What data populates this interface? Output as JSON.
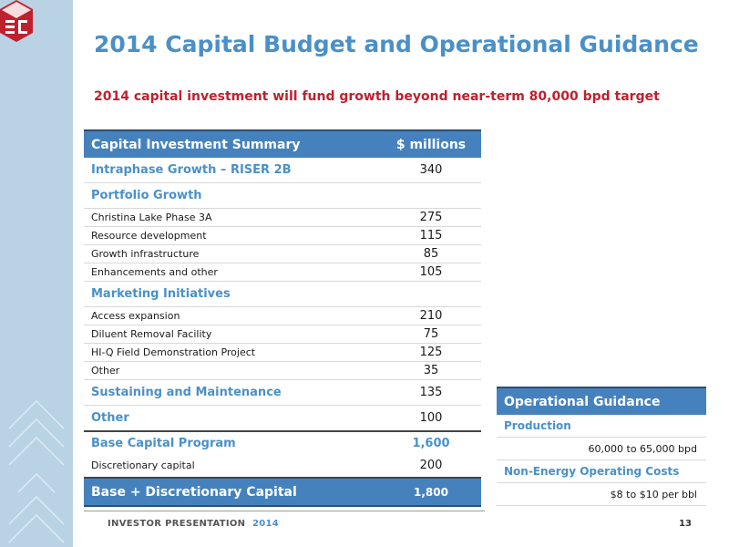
{
  "slide": {
    "title": "2014 Capital Budget and Operational Guidance",
    "subtitle": "2014 capital investment will fund growth beyond near-term 80,000 bpd target",
    "page_number": "13"
  },
  "footer": {
    "label": "INVESTOR PRESENTATION",
    "year": "2014"
  },
  "capital_table": {
    "header": {
      "col1": "Capital Investment Summary",
      "col2": "$ millions"
    },
    "rows": [
      {
        "label": "Intraphase Growth – RISER 2B",
        "value": "340"
      },
      {
        "label": "Portfolio Growth",
        "value": ""
      },
      {
        "label": "Christina Lake Phase 3A",
        "value": "275"
      },
      {
        "label": "Resource development",
        "value": "115"
      },
      {
        "label": "Growth infrastructure",
        "value": "85"
      },
      {
        "label": "Enhancements and other",
        "value": "105"
      },
      {
        "label": "Marketing Initiatives",
        "value": ""
      },
      {
        "label": "Access expansion",
        "value": "210"
      },
      {
        "label": "Diluent Removal Facility",
        "value": "75"
      },
      {
        "label": "HI-Q Field Demonstration Project",
        "value": "125"
      },
      {
        "label": "Other",
        "value": "35"
      },
      {
        "label": "Sustaining and Maintenance",
        "value": "135"
      },
      {
        "label": "Other",
        "value": "100"
      },
      {
        "label": "Base Capital Program",
        "value": "1,600"
      },
      {
        "label": "Discretionary capital",
        "value": "200"
      }
    ],
    "total": {
      "label": "Base + Discretionary Capital",
      "value": "1,800"
    }
  },
  "operational_guidance": {
    "header": "Operational Guidance",
    "production_label": "Production",
    "production_value": "60,000 to 65,000 bpd",
    "costs_label": "Non-Energy Operating Costs",
    "costs_value": "$8 to $10 per bbl"
  },
  "colors": {
    "accent_blue": "#4a90c8",
    "header_blue": "#4582bd",
    "red": "#c0202e",
    "sidebar": "#b9d3e5"
  }
}
